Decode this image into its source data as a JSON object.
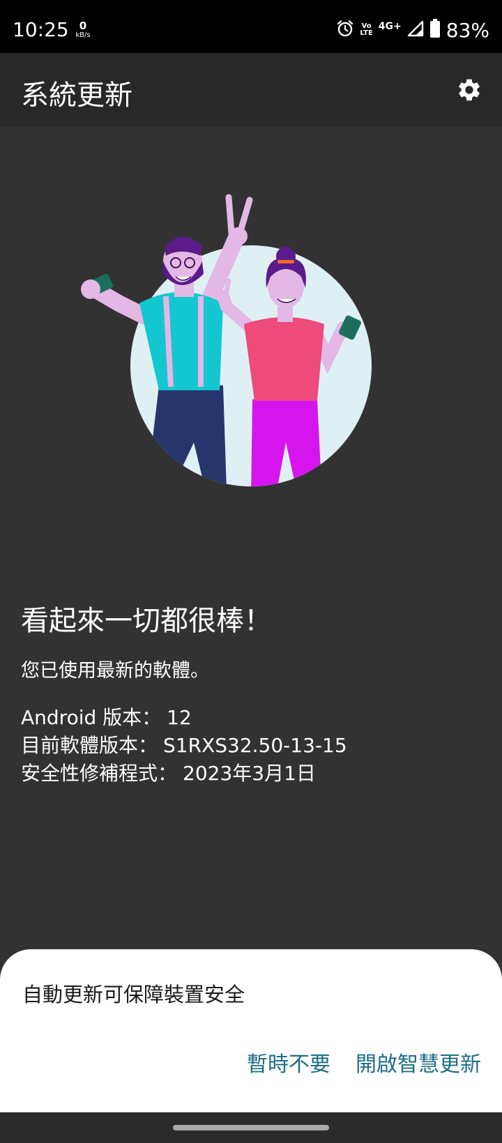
{
  "status_bar": {
    "time": "10:25",
    "net_speed_value": "0",
    "net_speed_unit": "kB/s",
    "volte_top": "Vo",
    "volte_bottom": "LTE",
    "network": "4G+",
    "battery_percent": "83%",
    "icons": [
      "alarm-icon",
      "signal-icon",
      "battery-icon"
    ]
  },
  "app_bar": {
    "title": "系統更新",
    "settings_icon": "gear-icon"
  },
  "main": {
    "heading": "看起來一切都很棒！",
    "subtext": "您已使用最新的軟體。",
    "info": [
      {
        "label": "Android 版本：",
        "value": "12"
      },
      {
        "label": "目前軟體版本：",
        "value": "S1RXS32.50-13-15"
      },
      {
        "label": "安全性修補程式：",
        "value": "2023年3月1日"
      }
    ]
  },
  "bottom_sheet": {
    "title": "自動更新可保障裝置安全",
    "later_label": "暫時不要",
    "enable_label": "開啟智慧更新"
  },
  "colors": {
    "background": "#323232",
    "app_bar": "#282828",
    "accent": "#1c6e86",
    "sheet": "#ffffff"
  }
}
